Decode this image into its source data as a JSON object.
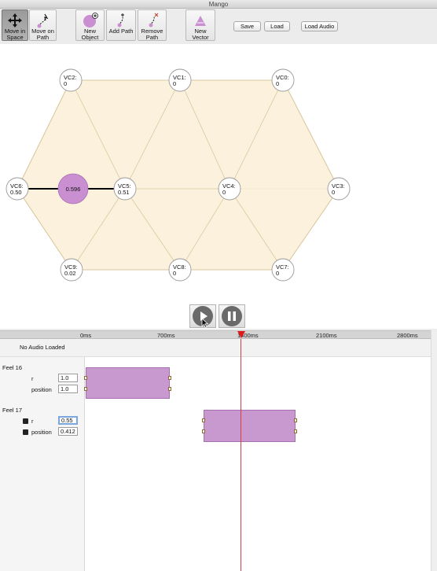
{
  "window": {
    "title": "Mango"
  },
  "toolbar": {
    "move_in_space": "Move in\nSpace",
    "move_on_path": "Move on\nPath",
    "new_object": "New\nObject",
    "add_path": "Add Path",
    "remove_path": "Remove\nPath",
    "new_vector": "New\nVector",
    "save": "Save",
    "load": "Load",
    "load_audio": "Load Audio"
  },
  "space": {
    "nodes": [
      {
        "name": "VC2:",
        "value": "0"
      },
      {
        "name": "VC1:",
        "value": "0"
      },
      {
        "name": "VC0:",
        "value": "0"
      },
      {
        "name": "VC6:",
        "value": "0.50"
      },
      {
        "name": "VC5:",
        "value": "0.51"
      },
      {
        "name": "VC4:",
        "value": "0"
      },
      {
        "name": "VC3:",
        "value": "0"
      },
      {
        "name": "VC9:",
        "value": "0.02"
      },
      {
        "name": "VC8:",
        "value": "0"
      },
      {
        "name": "VC7:",
        "value": "0"
      }
    ],
    "object_value": "0.596",
    "colors": {
      "fill": "#fcf1dc",
      "edge": "#d8c9a0",
      "object": "#c98fd1"
    }
  },
  "timeline": {
    "ticks": [
      "0ms",
      "700ms",
      "1400ms",
      "2100ms",
      "2800ms"
    ],
    "audio_status": "No Audio Loaded",
    "playhead_color": "#e01818"
  },
  "feels": [
    {
      "title": "Feel 16",
      "params": [
        {
          "label": "r",
          "value": "1.0"
        },
        {
          "label": "position",
          "value": "1.0"
        }
      ]
    },
    {
      "title": "Feel 17",
      "params": [
        {
          "label": "r",
          "value": "0.55"
        },
        {
          "label": "position",
          "value": "0.412"
        }
      ]
    }
  ]
}
